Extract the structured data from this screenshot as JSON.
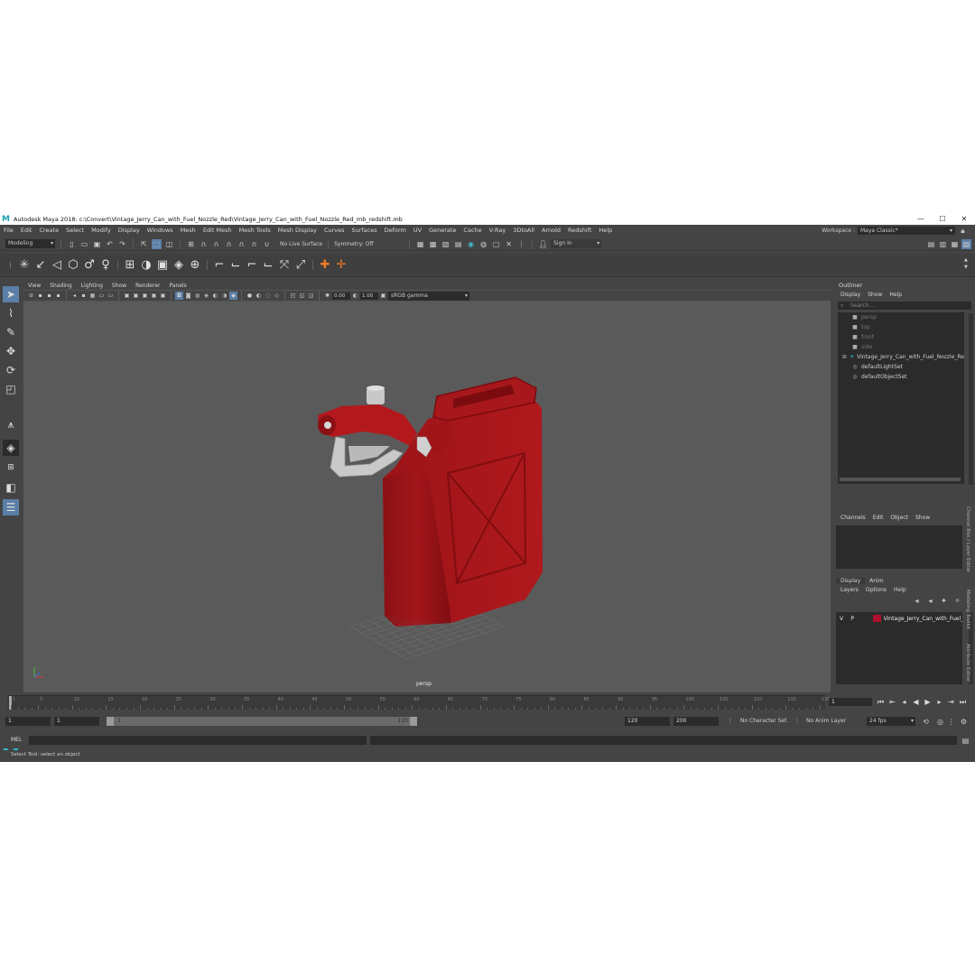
{
  "window": {
    "title": "Autodesk Maya 2018: c:\\Convert\\Vintage_Jerry_Can_with_Fuel_Nozzle_Red\\Vintage_Jerry_Can_with_Fuel_Nozzle_Red_mb_redshift.mb",
    "logo": "M",
    "minimize": "—",
    "maximize": "☐",
    "close": "✕"
  },
  "menubar": {
    "items": [
      "File",
      "Edit",
      "Create",
      "Select",
      "Modify",
      "Display",
      "Windows",
      "Mesh",
      "Edit Mesh",
      "Mesh Tools",
      "Mesh Display",
      "Curves",
      "Surfaces",
      "Deform",
      "UV",
      "Generate",
      "Cache",
      "V-Ray",
      "3DtoAll",
      "Arnold",
      "Redshift",
      "Help"
    ],
    "workspace_label": "Workspace :",
    "workspace_value": "Maya Classic*"
  },
  "statusline": {
    "mode": "Modeling",
    "live_surface": "No Live Surface",
    "symmetry": "Symmetry: Off",
    "sign_in": "Sign In"
  },
  "viewport": {
    "menu": [
      "View",
      "Shading",
      "Lighting",
      "Show",
      "Renderer",
      "Panels"
    ],
    "exposure": "0.00",
    "gamma": "1.00",
    "color_space": "sRGB gamma",
    "camera_label": "persp"
  },
  "outliner": {
    "title": "Outliner",
    "menu": [
      "Display",
      "Show",
      "Help"
    ],
    "search_placeholder": "Search...",
    "items": [
      {
        "label": "persp",
        "dim": true
      },
      {
        "label": "top",
        "dim": true
      },
      {
        "label": "front",
        "dim": true
      },
      {
        "label": "side",
        "dim": true
      },
      {
        "label": "Vintage_Jerry_Can_with_Fuel_Nozzle_Re",
        "dim": false
      },
      {
        "label": "defaultLightSet",
        "dim": false
      },
      {
        "label": "defaultObjectSet",
        "dim": false
      }
    ]
  },
  "channels": {
    "menu": [
      "Channels",
      "Edit",
      "Object",
      "Show"
    ]
  },
  "layers": {
    "tabs": [
      "Display",
      "Anim"
    ],
    "menu": [
      "Layers",
      "Options",
      "Help"
    ],
    "row": {
      "v": "V",
      "p": "P",
      "name": "Vintage_Jerry_Can_with_Fuel_N",
      "color": "#b01030"
    }
  },
  "side_tabs": [
    "Channel Box / Layer Editor",
    "Modeling Toolkit",
    "Attribute Editor"
  ],
  "timeline": {
    "ticks": [
      "1",
      "5",
      "10",
      "15",
      "20",
      "25",
      "30",
      "35",
      "40",
      "45",
      "50",
      "55",
      "60",
      "65",
      "70",
      "75",
      "80",
      "85",
      "90",
      "95",
      "100",
      "105",
      "110",
      "115",
      "120"
    ],
    "current_frame": "1"
  },
  "range": {
    "start": "1",
    "start_inner": "1",
    "slider_start": "1",
    "slider_end": "120",
    "end_inner": "120",
    "end": "200",
    "character_set": "No Character Set",
    "anim_layer": "No Anim Layer",
    "fps": "24 fps"
  },
  "command": {
    "mel_label": "MEL",
    "help_text": "Select Tool: select an object"
  },
  "colors": {
    "jerry_can": "#9e1418",
    "nozzle_handle": "#c8c8c8",
    "maya_logo": "#2cb8c8"
  }
}
